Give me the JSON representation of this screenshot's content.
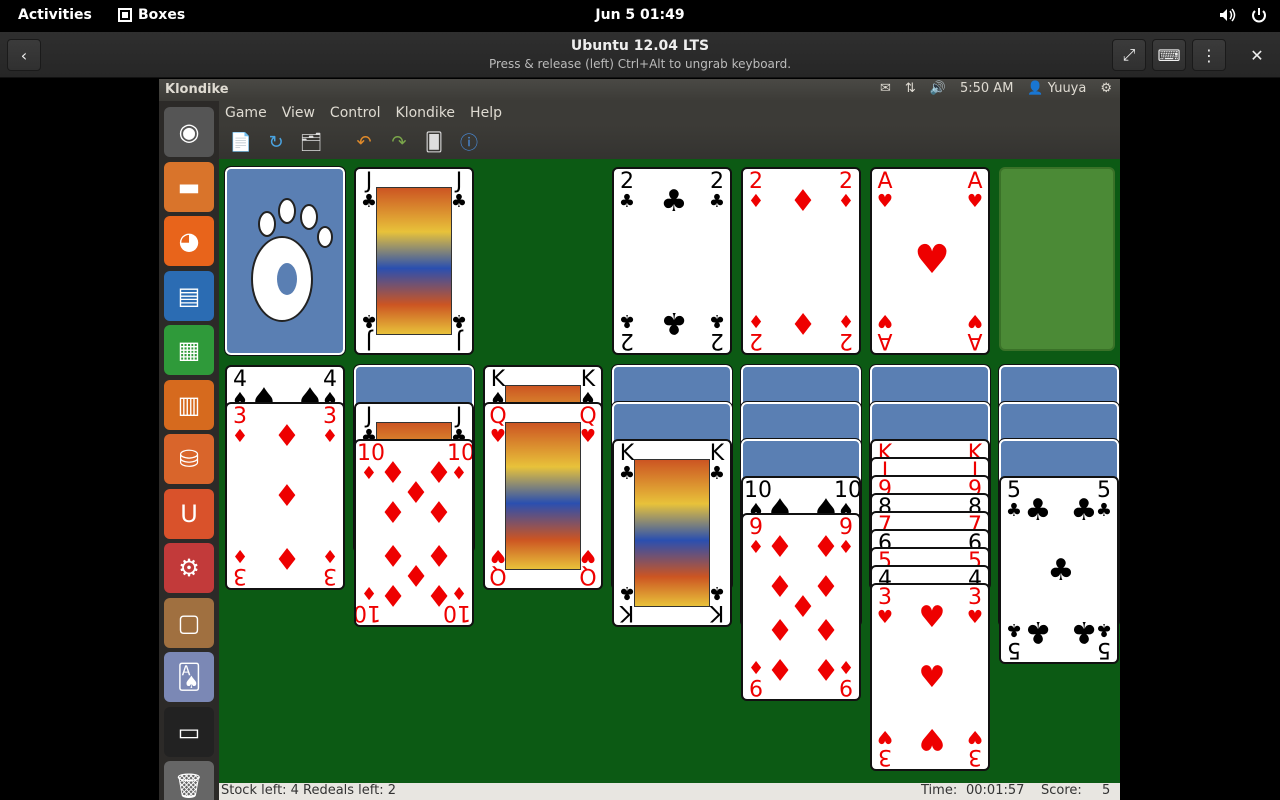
{
  "gnome": {
    "activities": "Activities",
    "app_name": "Boxes",
    "clock": "Jun 5  01:49",
    "volume_icon": "speaker-icon",
    "power_icon": "power-icon"
  },
  "boxes": {
    "title": "Ubuntu 12.04 LTS",
    "subtitle": "Press & release (left) Ctrl+Alt to ungrab keyboard."
  },
  "unity_panel": {
    "window_title": "Klondike",
    "time": "5:50 AM",
    "user": "Yuuya"
  },
  "menu": [
    "Game",
    "View",
    "Control",
    "Klondike",
    "Help"
  ],
  "launcher": [
    "ubuntu-dash-icon",
    "files-icon",
    "firefox-icon",
    "libreoffice-writer-icon",
    "libreoffice-calc-icon",
    "libreoffice-impress-icon",
    "software-center-icon",
    "ubuntu-one-icon",
    "system-settings-icon",
    "workspace-switcher-icon",
    "aisleriot-solitaire-icon",
    "terminal-icon",
    "trash-icon"
  ],
  "toolbar": [
    "new-game-icon",
    "restart-icon",
    "select-game-icon",
    "undo-icon",
    "redo-icon",
    "deal-icon",
    "hint-icon"
  ],
  "cards": {
    "waste_top": {
      "rank": "J",
      "suit": "♣",
      "color": "black"
    },
    "foundations": [
      {
        "rank": "2",
        "suit": "♣",
        "color": "black"
      },
      {
        "rank": "2",
        "suit": "♦",
        "color": "red"
      },
      {
        "rank": "A",
        "suit": "♥",
        "color": "red"
      }
    ],
    "tableau": [
      {
        "down": 0,
        "up": [
          {
            "rank": "4",
            "suit": "♠",
            "color": "black"
          },
          {
            "rank": "3",
            "suit": "♦",
            "color": "red"
          }
        ]
      },
      {
        "down": 1,
        "up": [
          {
            "rank": "J",
            "suit": "♣",
            "color": "black"
          },
          {
            "rank": "10",
            "suit": "♦",
            "color": "red"
          }
        ]
      },
      {
        "down": 0,
        "up": [
          {
            "rank": "K",
            "suit": "♠",
            "color": "black"
          },
          {
            "rank": "Q",
            "suit": "♥",
            "color": "red"
          }
        ]
      },
      {
        "down": 2,
        "up": [
          {
            "rank": "K",
            "suit": "♣",
            "color": "black"
          }
        ]
      },
      {
        "down": 3,
        "up": [
          {
            "rank": "10",
            "suit": "♠",
            "color": "black"
          },
          {
            "rank": "9",
            "suit": "♦",
            "color": "red"
          }
        ]
      },
      {
        "down": 2,
        "up": [
          {
            "rank": "K",
            "suit": "♥",
            "color": "red"
          },
          {
            "rank": "J",
            "suit": "♥",
            "color": "red"
          },
          {
            "rank": "9",
            "suit": "♥",
            "color": "red"
          },
          {
            "rank": "8",
            "suit": "♠",
            "color": "black"
          },
          {
            "rank": "7",
            "suit": "♥",
            "color": "red"
          },
          {
            "rank": "6",
            "suit": "♠",
            "color": "black"
          },
          {
            "rank": "5",
            "suit": "♥",
            "color": "red"
          },
          {
            "rank": "4",
            "suit": "♠",
            "color": "black"
          },
          {
            "rank": "3",
            "suit": "♥",
            "color": "red"
          }
        ]
      },
      {
        "down": 3,
        "up": [
          {
            "rank": "5",
            "suit": "♣",
            "color": "black"
          }
        ]
      }
    ]
  },
  "status": {
    "stock": "Stock left: 4",
    "redeals": "Redeals left: 2",
    "time_label": "Time:",
    "time_value": "00:01:57",
    "score_label": "Score:",
    "score_value": "5"
  },
  "colors": {
    "felt": "#0c5a14",
    "card_back": "#5a7fb3",
    "empty_slot": "#4b8a36"
  }
}
